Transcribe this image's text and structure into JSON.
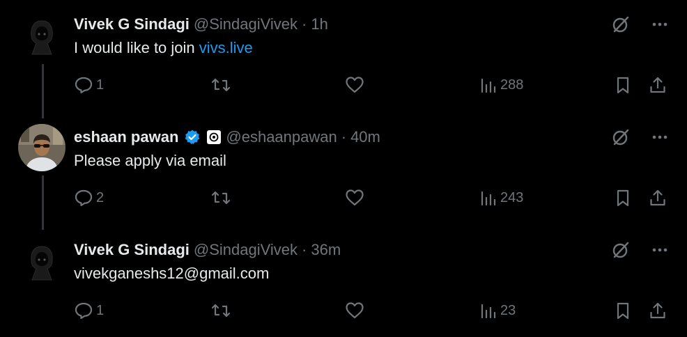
{
  "tweets": [
    {
      "name": "Vivek G Sindagi",
      "handle": "@SindagiVivek",
      "time": "1h",
      "text_parts": [
        "I would like to join ",
        "vivs.live"
      ],
      "replies": "1",
      "retweets": "",
      "likes": "",
      "views": "288",
      "avatar": "hooded-figure",
      "verified": false
    },
    {
      "name": "eshaan pawan",
      "handle": "@eshaanpawan",
      "time": "40m",
      "text_parts": [
        "Please apply via email"
      ],
      "replies": "2",
      "retweets": "",
      "likes": "",
      "views": "243",
      "avatar": "photo-man-sunglasses",
      "verified": true
    },
    {
      "name": "Vivek G Sindagi",
      "handle": "@SindagiVivek",
      "time": "36m",
      "text_parts": [
        "vivekganeshs12@gmail.com"
      ],
      "replies": "1",
      "retweets": "",
      "likes": "",
      "views": "23",
      "avatar": "hooded-figure",
      "verified": false
    }
  ],
  "colors": {
    "background": "#000000",
    "text": "#e7e9ea",
    "muted": "#71767b",
    "link": "#1d9bf0",
    "verified": "#1d9bf0",
    "thread_line": "#333639"
  },
  "icons": [
    "reply-icon",
    "retweet-icon",
    "like-icon",
    "views-icon",
    "bookmark-icon",
    "share-icon",
    "grok-icon",
    "more-icon",
    "verified-badge-icon",
    "affiliate-badge-icon"
  ]
}
